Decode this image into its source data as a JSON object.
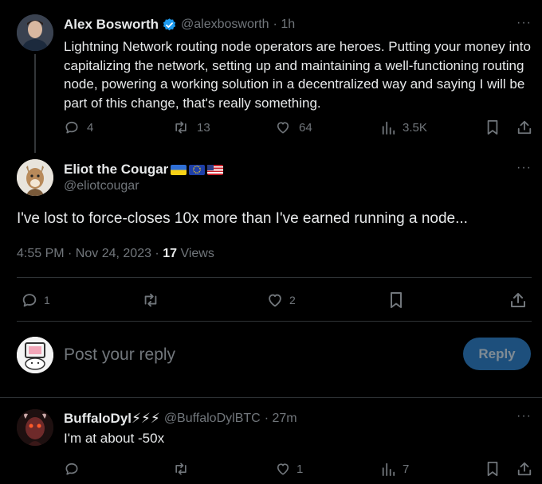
{
  "tweet1": {
    "name": "Alex Bosworth",
    "handle": "@alexbosworth",
    "time": "· 1h",
    "text": "Lightning Network routing node operators are heroes. Putting your money into capitalizing the network, setting up and maintaining a well-functioning routing node, powering a working solution in a decentralized way and saying I will be part of this change, that's really something.",
    "replies": "4",
    "retweets": "13",
    "likes": "64",
    "views": "3.5K",
    "more": "···"
  },
  "tweet2": {
    "name": "Eliot the Cougar",
    "handle": "@eliotcougar",
    "text": "I've lost to force-closes 10x more than I've earned running a node...",
    "time": "4:55 PM · Nov 24, 2023 · ",
    "views_count": "17",
    "views_label": " Views",
    "replies": "1",
    "likes": "2",
    "more": "···"
  },
  "reply_box": {
    "placeholder": "Post your reply",
    "button": "Reply"
  },
  "tweet3": {
    "name": "BuffaloDyl⚡⚡⚡",
    "handle": "@BuffaloDylBTC",
    "time": "· 27m",
    "text": "I'm at about -50x",
    "likes": "1",
    "views": "7",
    "more": "···"
  },
  "colors": {
    "verified": "#1d9bf0",
    "reply_button_bg": "#1d4f7c",
    "reply_button_text": "#7f8b94"
  }
}
